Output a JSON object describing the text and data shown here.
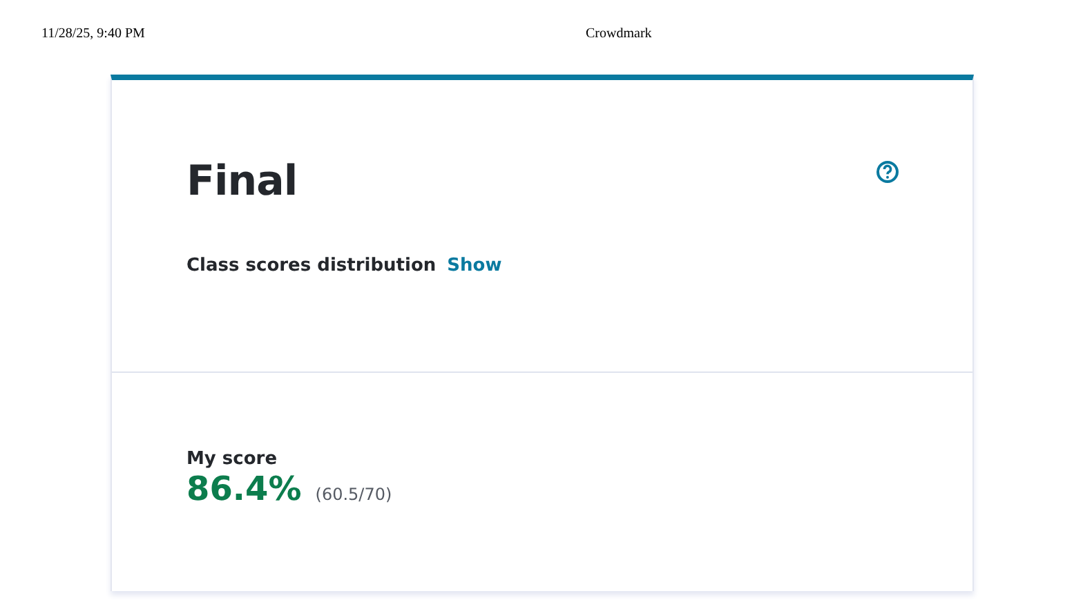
{
  "print_header": {
    "date": "11/28/25, 9:40 PM",
    "title": "Crowdmark"
  },
  "assessment": {
    "title": "Final",
    "distribution_label": "Class scores distribution",
    "distribution_link": "Show"
  },
  "score": {
    "label": "My score",
    "percent": "86.4%",
    "points": "(60.5/70)"
  }
}
